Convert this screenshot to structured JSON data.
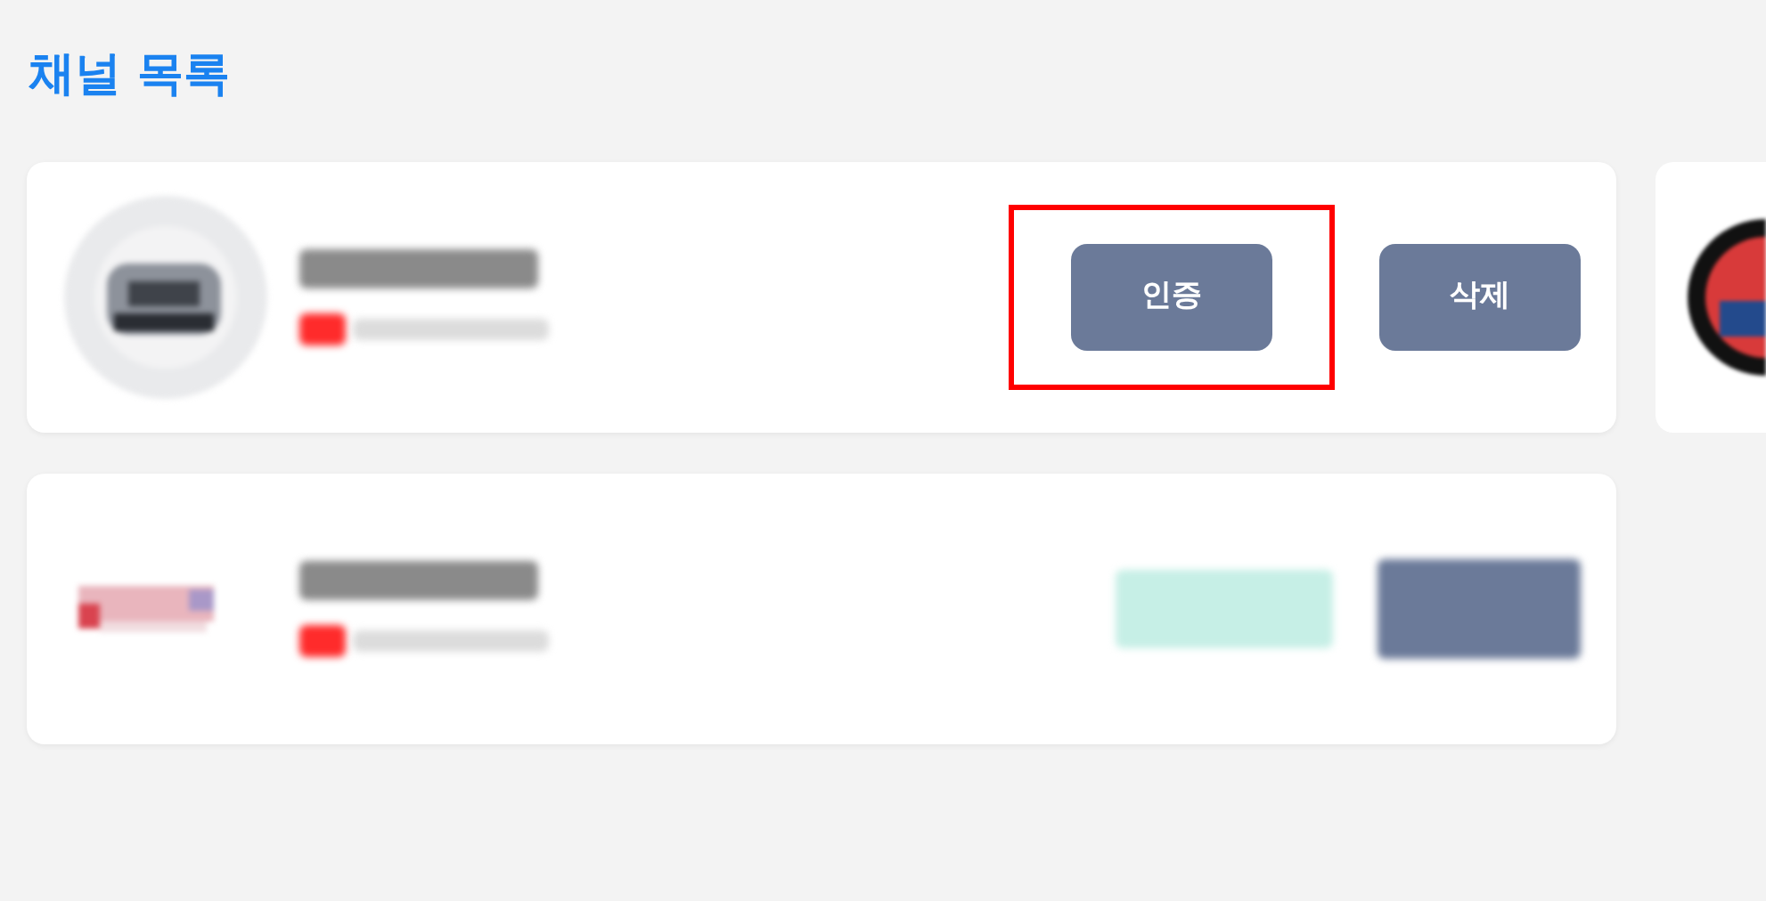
{
  "title": "채널 목록",
  "channels": [
    {
      "kind": "verifiable",
      "buttons": [
        {
          "label": "인증",
          "highlighted": true
        },
        {
          "label": "삭제",
          "highlighted": false
        }
      ]
    },
    {
      "kind": "verified"
    }
  ]
}
